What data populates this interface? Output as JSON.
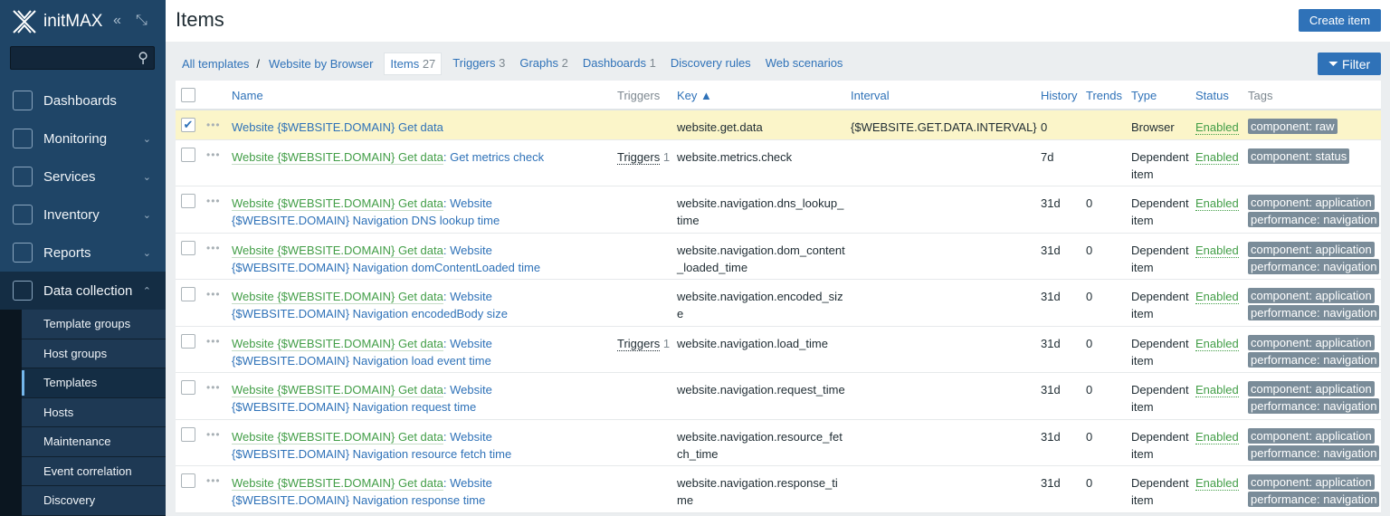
{
  "sidebar": {
    "brand": "initMAX",
    "menu": [
      {
        "label": "Dashboards",
        "icon": "dashboards-icon"
      },
      {
        "label": "Monitoring",
        "icon": "monitoring-icon"
      },
      {
        "label": "Services",
        "icon": "services-icon"
      },
      {
        "label": "Inventory",
        "icon": "inventory-icon"
      },
      {
        "label": "Reports",
        "icon": "reports-icon"
      },
      {
        "label": "Data collection",
        "icon": "data-collection-icon"
      }
    ],
    "submenu": [
      "Template groups",
      "Host groups",
      "Templates",
      "Hosts",
      "Maintenance",
      "Event correlation",
      "Discovery"
    ],
    "active_submenu": "Templates"
  },
  "header": {
    "title": "Items",
    "create_label": "Create item",
    "filter_label": "Filter"
  },
  "nav": {
    "all_templates": "All templates",
    "template": "Website by Browser",
    "tabs": [
      {
        "label": "Items",
        "count": "27"
      },
      {
        "label": "Triggers",
        "count": "3"
      },
      {
        "label": "Graphs",
        "count": "2"
      },
      {
        "label": "Dashboards",
        "count": "1"
      },
      {
        "label": "Discovery rules",
        "count": ""
      },
      {
        "label": "Web scenarios",
        "count": ""
      }
    ]
  },
  "columns": {
    "name": "Name",
    "triggers": "Triggers",
    "key": "Key ▲",
    "interval": "Interval",
    "history": "History",
    "trends": "Trends",
    "type": "Type",
    "status": "Status",
    "tags": "Tags"
  },
  "rows": [
    {
      "checked": true,
      "prefix": "",
      "name": "Website {$WEBSITE.DOMAIN} Get data",
      "triggers": "",
      "trig_count": "",
      "key": "website.get.data",
      "interval": "{$WEBSITE.GET.DATA.INTERVAL}",
      "history": "0",
      "trends": "",
      "type": "Browser",
      "status": "Enabled",
      "tags": [
        "component: raw"
      ]
    },
    {
      "checked": false,
      "prefix": "Website {$WEBSITE.DOMAIN} Get data",
      "name": "Get metrics check",
      "triggers": "Triggers",
      "trig_count": "1",
      "key": "website.metrics.check",
      "interval": "",
      "history": "7d",
      "trends": "",
      "type": "Dependent item",
      "status": "Enabled",
      "tags": [
        "component: status"
      ]
    },
    {
      "checked": false,
      "prefix": "Website {$WEBSITE.DOMAIN} Get data",
      "name": "Website {$WEBSITE.DOMAIN} Navigation DNS lookup time",
      "triggers": "",
      "trig_count": "",
      "key": "website.navigation.dns_lookup_time",
      "interval": "",
      "history": "31d",
      "trends": "0",
      "type": "Dependent item",
      "status": "Enabled",
      "tags": [
        "component: application",
        "performance: navigation"
      ]
    },
    {
      "checked": false,
      "prefix": "Website {$WEBSITE.DOMAIN} Get data",
      "name": "Website {$WEBSITE.DOMAIN} Navigation domContentLoaded time",
      "triggers": "",
      "trig_count": "",
      "key": "website.navigation.dom_content_loaded_time",
      "interval": "",
      "history": "31d",
      "trends": "0",
      "type": "Dependent item",
      "status": "Enabled",
      "tags": [
        "component: application",
        "performance: navigation"
      ]
    },
    {
      "checked": false,
      "prefix": "Website {$WEBSITE.DOMAIN} Get data",
      "name": "Website {$WEBSITE.DOMAIN} Navigation encodedBody size",
      "triggers": "",
      "trig_count": "",
      "key": "website.navigation.encoded_size",
      "interval": "",
      "history": "31d",
      "trends": "0",
      "type": "Dependent item",
      "status": "Enabled",
      "tags": [
        "component: application",
        "performance: navigation"
      ]
    },
    {
      "checked": false,
      "prefix": "Website {$WEBSITE.DOMAIN} Get data",
      "name": "Website {$WEBSITE.DOMAIN} Navigation load event time",
      "triggers": "Triggers",
      "trig_count": "1",
      "key": "website.navigation.load_time",
      "interval": "",
      "history": "31d",
      "trends": "0",
      "type": "Dependent item",
      "status": "Enabled",
      "tags": [
        "component: application",
        "performance: navigation"
      ]
    },
    {
      "checked": false,
      "prefix": "Website {$WEBSITE.DOMAIN} Get data",
      "name": "Website {$WEBSITE.DOMAIN} Navigation request time",
      "triggers": "",
      "trig_count": "",
      "key": "website.navigation.request_time",
      "interval": "",
      "history": "31d",
      "trends": "0",
      "type": "Dependent item",
      "status": "Enabled",
      "tags": [
        "component: application",
        "performance: navigation"
      ]
    },
    {
      "checked": false,
      "prefix": "Website {$WEBSITE.DOMAIN} Get data",
      "name": "Website {$WEBSITE.DOMAIN} Navigation resource fetch time",
      "triggers": "",
      "trig_count": "",
      "key": "website.navigation.resource_fetch_time",
      "interval": "",
      "history": "31d",
      "trends": "0",
      "type": "Dependent item",
      "status": "Enabled",
      "tags": [
        "component: application",
        "performance: navigation"
      ]
    },
    {
      "checked": false,
      "prefix": "Website {$WEBSITE.DOMAIN} Get data",
      "name": "Website {$WEBSITE.DOMAIN} Navigation response time",
      "triggers": "",
      "trig_count": "",
      "key": "website.navigation.response_time",
      "interval": "",
      "history": "31d",
      "trends": "0",
      "type": "Dependent item",
      "status": "Enabled",
      "tags": [
        "component: application",
        "performance: navigation"
      ]
    }
  ]
}
